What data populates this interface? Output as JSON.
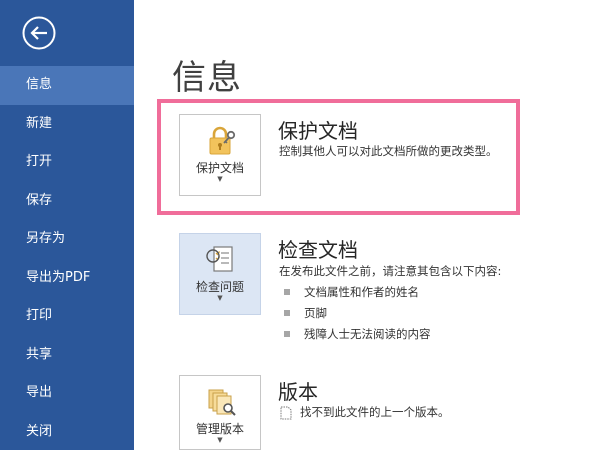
{
  "sidebar": {
    "back_icon": "back-arrow-icon",
    "items": [
      {
        "label": "信息",
        "active": true
      },
      {
        "label": "新建"
      },
      {
        "label": "打开"
      },
      {
        "label": "保存"
      },
      {
        "label": "另存为"
      },
      {
        "label": "导出为PDF"
      },
      {
        "label": "打印"
      },
      {
        "label": "共享"
      },
      {
        "label": "导出"
      },
      {
        "label": "关闭"
      }
    ]
  },
  "main": {
    "title": "信息",
    "protect": {
      "tile_label": "保护文档",
      "tile_icon": "lock-key-icon",
      "title": "保护文档",
      "description": "控制其他人可以对此文档所做的更改类型。"
    },
    "inspect": {
      "tile_label": "检查问题",
      "tile_icon": "checklist-icon",
      "title": "检查文档",
      "description": "在发布此文件之前，请注意其包含以下内容:",
      "bullets": [
        "文档属性和作者的姓名",
        "页脚",
        "残障人士无法阅读的内容"
      ]
    },
    "versions": {
      "tile_label": "管理版本",
      "tile_icon": "documents-magnifier-icon",
      "title": "版本",
      "description": "找不到此文件的上一个版本。"
    }
  },
  "colors": {
    "sidebar": "#2b579a",
    "sidebar_active": "#4a76b8",
    "highlight": "#f06d9a",
    "tile_selected": "#dce6f4"
  }
}
